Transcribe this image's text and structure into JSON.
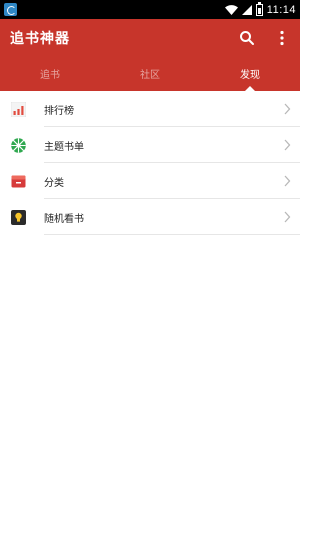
{
  "status_bar": {
    "time": "11:14"
  },
  "app_bar": {
    "title": "追书神器",
    "search_icon": "search-icon",
    "more_icon": "more-vertical-icon"
  },
  "tabs": [
    {
      "label": "追书",
      "active": false
    },
    {
      "label": "社区",
      "active": false
    },
    {
      "label": "发现",
      "active": true
    }
  ],
  "list": [
    {
      "label": "排行榜",
      "icon": "ranking-chart-icon"
    },
    {
      "label": "主题书单",
      "icon": "booklist-icon"
    },
    {
      "label": "分类",
      "icon": "category-box-icon"
    },
    {
      "label": "随机看书",
      "icon": "lightbulb-icon"
    }
  ],
  "colors": {
    "primary": "#c7352b",
    "status_bar": "#000000"
  }
}
